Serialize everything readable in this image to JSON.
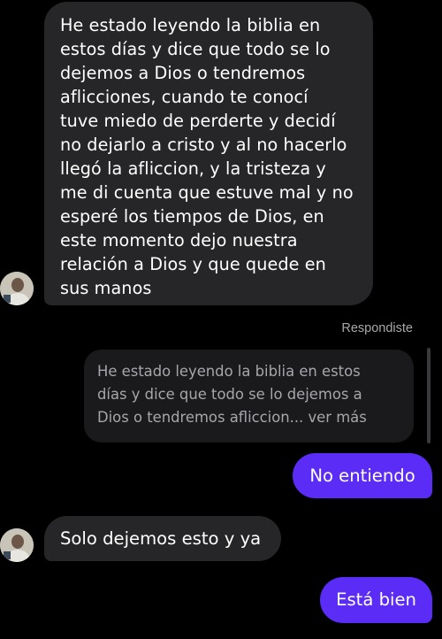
{
  "conversation": {
    "messages": [
      {
        "direction": "incoming",
        "text": "He estado leyendo la biblia en\nestos días y dice que todo se lo\ndejemos a Dios o tendremos\naflicciones, cuando te conocí\ntuve miedo de perderte y decidí\nno dejarlo a cristo y al no hacerlo\nllegó la afliccion, y la tristeza y\nme di cuenta que estuve mal y no\nesperé los tiempos de Dios, en\neste momento dejo nuestra\nrelación a Dios y que quede en\nsus manos"
      },
      {
        "direction": "outgoing",
        "reply_label": "Respondiste",
        "quoted_text": "He estado leyendo la biblia en estos\ndías y dice que todo se lo dejemos a\nDios o tendremos afliccion... ver más",
        "text": "No entiendo"
      },
      {
        "direction": "incoming",
        "text": "Solo dejemos esto y ya"
      },
      {
        "direction": "outgoing",
        "text": "Está bien"
      }
    ]
  },
  "colors": {
    "background": "#000000",
    "incoming_bubble": "#262629",
    "outgoing_bubble": "#5b2cf5",
    "quoted_bubble": "#1a1a1c",
    "secondary_text": "#a8a8ad"
  },
  "icons": {
    "contact_avatar": "contact-avatar-photo"
  }
}
